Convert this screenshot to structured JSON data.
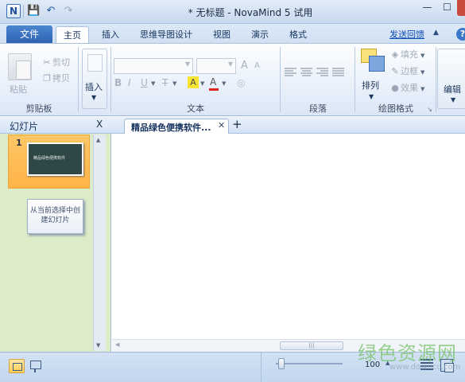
{
  "window": {
    "title": "* 无标题 - NovaMind 5 试用",
    "app_icon": "N",
    "controls": {
      "minimize": "—",
      "maximize": "☐",
      "close": "✕"
    }
  },
  "quick_access": {
    "save": "💾",
    "undo": "↶",
    "redo": "↷"
  },
  "ribbon_tabs": {
    "file": "文件",
    "items": [
      "主页",
      "插入",
      "思维导图设计",
      "视图",
      "演示",
      "格式"
    ],
    "active": "主页",
    "feedback_link": "发送回馈",
    "help": "?",
    "minimize_ribbon": "▲"
  },
  "ribbon": {
    "clipboard": {
      "paste": "粘贴",
      "cut": "剪切",
      "copy": "拷贝",
      "label": "剪贴板"
    },
    "insert": {
      "label": "插入",
      "arrow": "▼"
    },
    "text": {
      "label": "文本",
      "grow_font": "A",
      "shrink_font": "A",
      "bold": "B",
      "italic": "I",
      "underline": "U",
      "strike": "T",
      "highlight": "A",
      "font_color": "A"
    },
    "paragraph": {
      "label": "段落"
    },
    "drawing": {
      "label": "绘图格式",
      "arrange": "排列",
      "fill": "填充",
      "border": "边框",
      "effect": "效果",
      "arrow": "▼",
      "launcher": "↘"
    },
    "edit": {
      "label": "编辑",
      "arrow": "▼"
    }
  },
  "slides_pane": {
    "title": "幻灯片",
    "close": "X",
    "slides": [
      {
        "number": "1",
        "thumb_text": "精品绿色便携软件"
      }
    ],
    "new_slide_card": "从当前选择中创建幻灯片",
    "scroll_up": "▲",
    "scroll_down": "▼"
  },
  "document": {
    "tab_label": "精品绿色便携软件...",
    "tab_close": "✕",
    "new_tab": "+"
  },
  "hscroll": {
    "left": "◀",
    "thumb": "|||"
  },
  "statusbar": {
    "zoom_value": "100",
    "zoom_up": "▲"
  },
  "watermark": {
    "text": "绿色资源网",
    "url": "www.downcc.com"
  },
  "colors": {
    "file_tab": "#2f62b2",
    "slide_selected": "#ffb347",
    "slides_pane_bg": "#dcecc8",
    "close_button": "#c94b3f"
  }
}
